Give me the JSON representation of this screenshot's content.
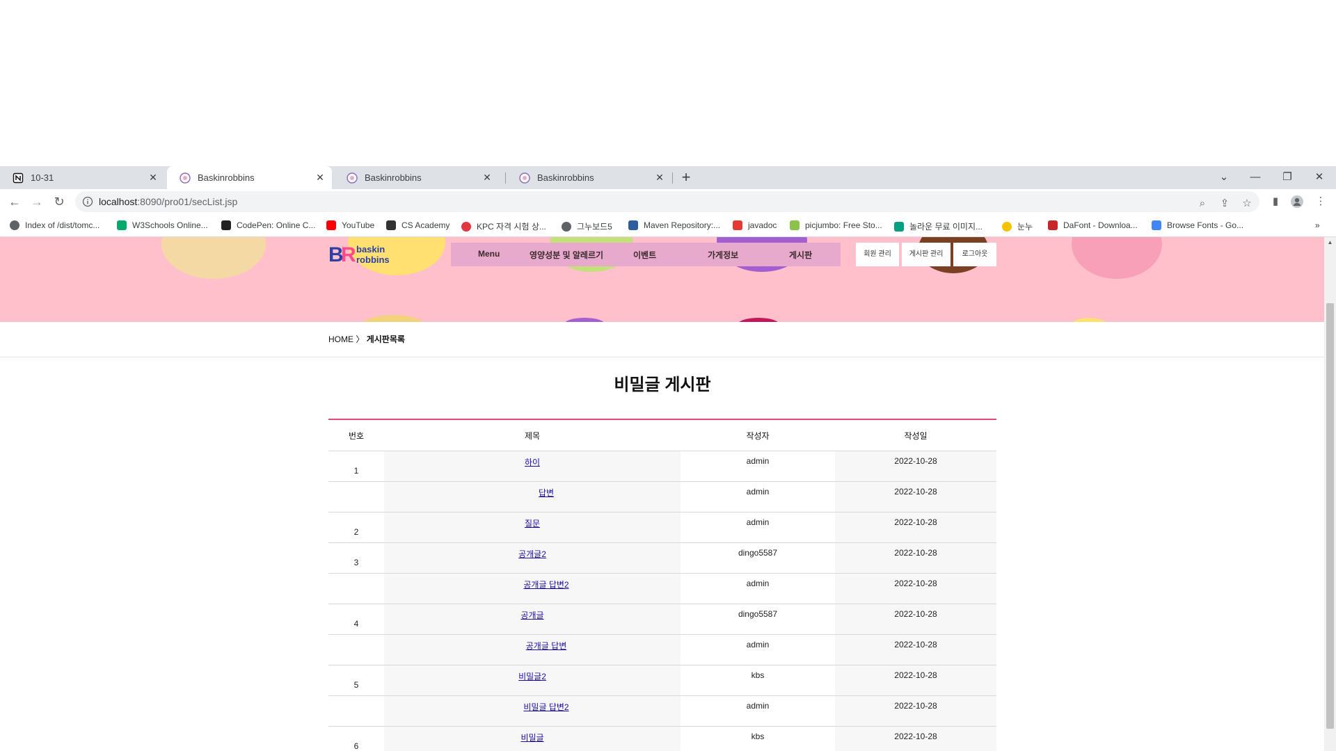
{
  "browser": {
    "tabs": [
      {
        "title": "10-31",
        "icon": "notion-icon"
      },
      {
        "title": "Baskinrobbins",
        "icon": "baskin-favicon"
      },
      {
        "title": "Baskinrobbins",
        "icon": "baskin-favicon"
      },
      {
        "title": "Baskinrobbins",
        "icon": "baskin-favicon"
      }
    ],
    "url_host": "localhost",
    "url_rest": ":8090/pro01/secList.jsp",
    "bookmarks": [
      {
        "label": "Index of /dist/tomc...",
        "color": "#5f6368"
      },
      {
        "label": "W3Schools Online...",
        "color": "#04aa6d"
      },
      {
        "label": "CodePen: Online C...",
        "color": "#222222"
      },
      {
        "label": "YouTube",
        "color": "#ff0000"
      },
      {
        "label": "CS Academy",
        "color": "#333333"
      },
      {
        "label": "KPC 자격 시험 상...",
        "color": "#e0383e"
      },
      {
        "label": "그누보드5",
        "color": "#5f6368"
      },
      {
        "label": "Maven Repository:...",
        "color": "#2d5d9f"
      },
      {
        "label": "javadoc",
        "color": "#e53935"
      },
      {
        "label": "picjumbo: Free Sto...",
        "color": "#8bc34a"
      },
      {
        "label": "놀라운 무료 이미지...",
        "color": "#05a081"
      },
      {
        "label": "눈누",
        "color": "#f5c400"
      },
      {
        "label": "DaFont - Downloa...",
        "color": "#c62828"
      },
      {
        "label": "Browse Fonts - Go...",
        "color": "#4285f4"
      }
    ]
  },
  "site": {
    "logo_text": "baskin robbins",
    "logo_mark": "BR",
    "nav": [
      "Menu",
      "영양성분 및 알레르기",
      "이벤트",
      "가게정보",
      "게시판"
    ],
    "auth": [
      "회원 관리",
      "게시판 관리",
      "로그아웃"
    ],
    "breadcrumb_home": "HOME",
    "breadcrumb_sep": "〉",
    "breadcrumb_current": "게시판목록",
    "board_title": "비밀글 게시판",
    "columns": [
      "번호",
      "제목",
      "작성자",
      "작성일"
    ],
    "rows": [
      {
        "no": "1",
        "title": "하이",
        "reply": false,
        "author": "admin",
        "date": "2022-10-28"
      },
      {
        "no": "",
        "title": "답변",
        "reply": true,
        "author": "admin",
        "date": "2022-10-28"
      },
      {
        "no": "2",
        "title": "질문",
        "reply": false,
        "author": "admin",
        "date": "2022-10-28"
      },
      {
        "no": "3",
        "title": "공개글2",
        "reply": false,
        "author": "dingo5587",
        "date": "2022-10-28"
      },
      {
        "no": "",
        "title": "공개글 답변2",
        "reply": true,
        "author": "admin",
        "date": "2022-10-28"
      },
      {
        "no": "4",
        "title": "공개글",
        "reply": false,
        "author": "dingo5587",
        "date": "2022-10-28"
      },
      {
        "no": "",
        "title": "공개글 답변",
        "reply": true,
        "author": "admin",
        "date": "2022-10-28"
      },
      {
        "no": "5",
        "title": "비밀글2",
        "reply": false,
        "author": "kbs",
        "date": "2022-10-28"
      },
      {
        "no": "",
        "title": "비밀글 답변2",
        "reply": true,
        "author": "admin",
        "date": "2022-10-28"
      },
      {
        "no": "6",
        "title": "비밀글",
        "reply": false,
        "author": "kbs",
        "date": "2022-10-28"
      }
    ]
  },
  "colors": {
    "hero_bg": "#ffc0cb",
    "nav_bg": "#e7a9cc",
    "table_accent": "#e2467f",
    "logo_blue": "#2d3fa4",
    "logo_pink": "#ff4b8b"
  }
}
